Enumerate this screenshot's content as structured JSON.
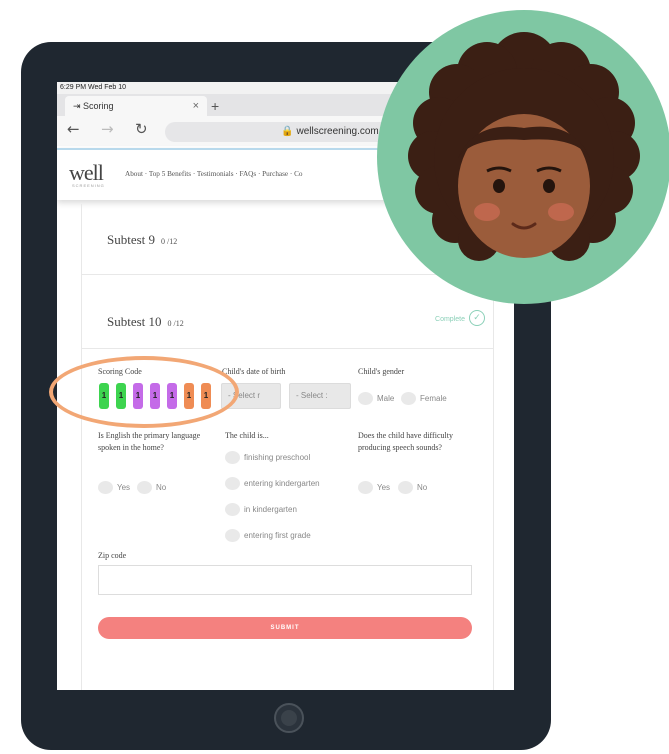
{
  "status_bar": {
    "time": "6:29 PM  Wed Feb 10"
  },
  "browser": {
    "tab_title": "Scoring",
    "tab_close": "×",
    "new_tab": "+",
    "url": "🔒 wellscreening.com"
  },
  "site": {
    "logo": "well",
    "logo_sub": "SCREENING",
    "nav": "About  ·  Top 5 Benefits  ·  Testimonials  ·  FAQs  ·  Purchase  ·  Co"
  },
  "subtests": [
    {
      "name": "Subtest 9",
      "score": "0 /12"
    },
    {
      "name": "Subtest 10",
      "score": "0 /12",
      "status": "Complete"
    }
  ],
  "form": {
    "scoring_code_label": "Scoring Code",
    "scoring_code": [
      {
        "digit": "1",
        "color": "#3dd44f"
      },
      {
        "digit": "1",
        "color": "#3dd44f"
      },
      {
        "digit": "1",
        "color": "#c46be8"
      },
      {
        "digit": "1",
        "color": "#c46be8"
      },
      {
        "digit": "1",
        "color": "#c46be8"
      },
      {
        "digit": "1",
        "color": "#ef8c54"
      },
      {
        "digit": "1",
        "color": "#ef8c54"
      }
    ],
    "dob_label": "Child's date of birth",
    "dob_select_1": "- Select r",
    "dob_select_2": "- Select :",
    "gender_label": "Child's gender",
    "gender_options": [
      "Male",
      "Female"
    ],
    "english_label": "Is English the primary language spoken in the home?",
    "english_options": [
      "Yes",
      "No"
    ],
    "child_is_label": "The child is...",
    "child_is_options": [
      "finishing preschool",
      "entering kindergarten",
      "in kindergarten",
      "entering first grade"
    ],
    "speech_label": "Does the child have difficulty producing speech sounds?",
    "speech_options": [
      "Yes",
      "No"
    ],
    "zip_label": "Zip code",
    "submit_label": "SUBMIT"
  },
  "colors": {
    "tablet": "#1f2730",
    "highlight": "#f2a775",
    "submit": "#f4817f",
    "complete": "#8bd0b8",
    "avatar_bg": "#7fc7a3"
  }
}
